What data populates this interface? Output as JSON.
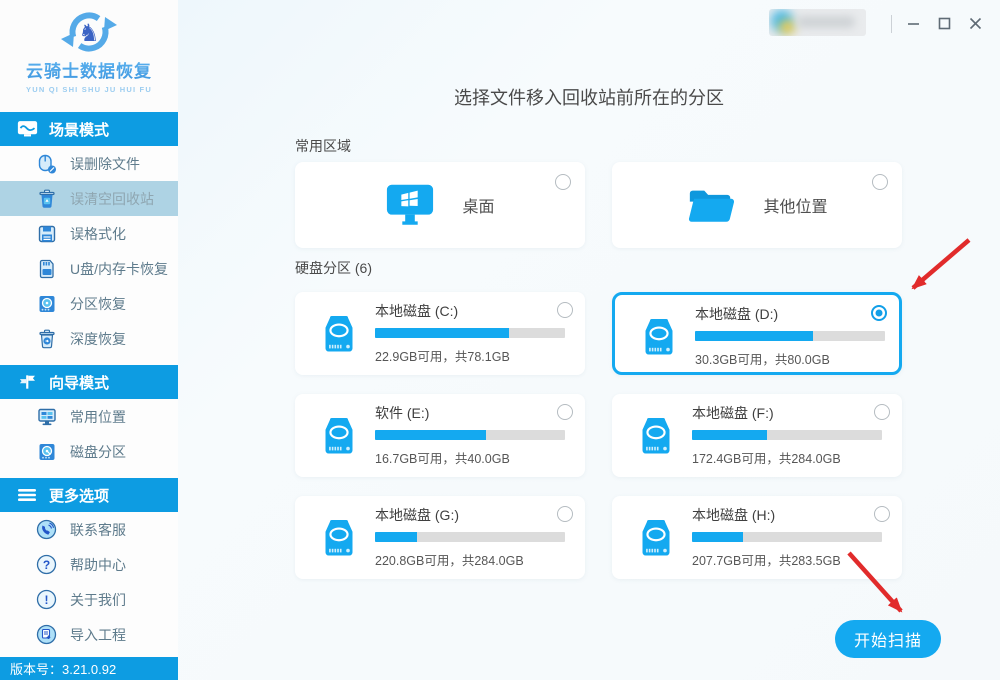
{
  "sidebar": {
    "logo": {
      "title": "云骑士数据恢复",
      "subtitle": "YUN QI SHI SHU JU HUI FU"
    },
    "sections": [
      {
        "label": "场景模式",
        "icon": "scene-mode-icon",
        "items": [
          {
            "label": "误删除文件",
            "icon": "mouse-icon",
            "active": false
          },
          {
            "label": "误清空回收站",
            "icon": "recycle-bin-icon",
            "active": true
          },
          {
            "label": "误格式化",
            "icon": "format-disk-icon",
            "active": false
          },
          {
            "label": "U盘/内存卡恢复",
            "icon": "memory-card-icon",
            "active": false
          },
          {
            "label": "分区恢复",
            "icon": "partition-icon",
            "active": false
          },
          {
            "label": "深度恢复",
            "icon": "deep-recovery-icon",
            "active": false
          }
        ]
      },
      {
        "label": "向导模式",
        "icon": "signpost-icon",
        "items": [
          {
            "label": "常用位置",
            "icon": "monitor-icon",
            "active": false
          },
          {
            "label": "磁盘分区",
            "icon": "disk-icon",
            "active": false
          }
        ]
      },
      {
        "label": "更多选项",
        "icon": "menu-icon",
        "items": [
          {
            "label": "联系客服",
            "icon": "phone-icon",
            "active": false
          },
          {
            "label": "帮助中心",
            "icon": "question-icon",
            "active": false
          },
          {
            "label": "关于我们",
            "icon": "info-icon",
            "active": false
          },
          {
            "label": "导入工程",
            "icon": "import-icon",
            "active": false
          }
        ]
      }
    ],
    "version_label": "版本号：3.21.0.92"
  },
  "titlebar": {
    "minimize": "最小化",
    "maximize": "最大化",
    "close": "关闭"
  },
  "main": {
    "title": "选择文件移入回收站前所在的分区",
    "common_section_label": "常用区域",
    "common_items": [
      {
        "label": "桌面",
        "icon": "desktop-icon",
        "selected": false
      },
      {
        "label": "其他位置",
        "icon": "folder-icon",
        "selected": false
      }
    ],
    "partition_section_label": "硬盘分区 (6)",
    "disks": [
      {
        "name": "本地磁盘 (C:)",
        "capacity": "22.9GB可用，共78.1GB",
        "used_percent": 70.7,
        "selected": false
      },
      {
        "name": "本地磁盘 (D:)",
        "capacity": "30.3GB可用，共80.0GB",
        "used_percent": 62.1,
        "selected": true
      },
      {
        "name": "软件 (E:)",
        "capacity": "16.7GB可用，共40.0GB",
        "used_percent": 58.3,
        "selected": false
      },
      {
        "name": "本地磁盘 (F:)",
        "capacity": "172.4GB可用，共284.0GB",
        "used_percent": 39.3,
        "selected": false
      },
      {
        "name": "本地磁盘 (G:)",
        "capacity": "220.8GB可用，共284.0GB",
        "used_percent": 22.3,
        "selected": false
      },
      {
        "name": "本地磁盘 (H:)",
        "capacity": "207.7GB可用，共283.5GB",
        "used_percent": 26.7,
        "selected": false
      }
    ],
    "scan_button_label": "开始扫描"
  },
  "colors": {
    "accent": "#14a9f0",
    "sidebar_header": "#0d9ce2",
    "selected_item_bg": "#aed3e4",
    "progress_track": "#dcdcdc",
    "annotation_arrow": "#e12b2b"
  }
}
